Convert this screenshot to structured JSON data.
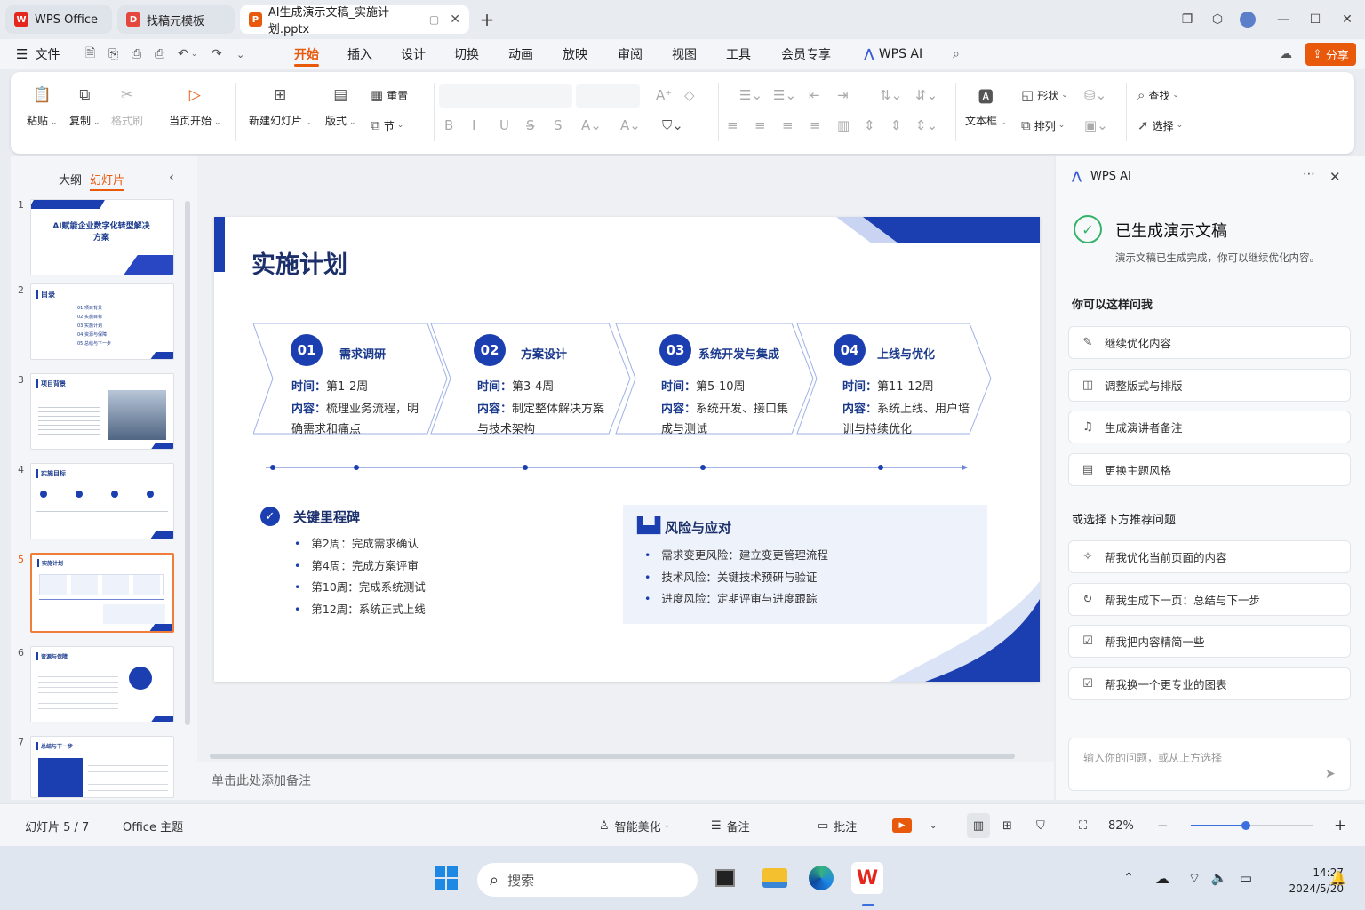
{
  "tabs": [
    {
      "label": "WPS Office"
    },
    {
      "label": "找稿元模板"
    },
    {
      "label": "AI生成演示文稿_实施计划.pptx"
    }
  ],
  "menu": {
    "file": "文件",
    "items": [
      "开始",
      "插入",
      "设计",
      "切换",
      "动画",
      "放映",
      "审阅",
      "视图",
      "工具",
      "会员专享"
    ],
    "wps_ai": "WPS AI",
    "share": "分享"
  },
  "ribbon": {
    "paste": "粘贴",
    "copy": "复制",
    "format_painter": "格式刷",
    "from_current": "当页开始",
    "new_slide": "新建幻灯片",
    "layout": "版式",
    "reset": "重置",
    "section": "节",
    "textbox": "文本框",
    "shape": "形状",
    "arrange": "排列",
    "find": "查找",
    "select": "选择"
  },
  "leftpanel": {
    "outline": "大纲",
    "slides": "幻灯片",
    "thumbs": [
      {
        "num": "1",
        "title": "AI赋能企业数字化转型解决方案"
      },
      {
        "num": "2",
        "title": "目录",
        "items": [
          "01 项目背景",
          "02 实施目标",
          "03 实施计划",
          "04 资源与保障",
          "05 总结与下一步"
        ]
      },
      {
        "num": "3",
        "title": "项目背景"
      },
      {
        "num": "4",
        "title": "实施目标"
      },
      {
        "num": "5",
        "title": "实施计划"
      },
      {
        "num": "6",
        "title": "资源与保障"
      },
      {
        "num": "7",
        "title": "总结与下一步"
      }
    ]
  },
  "slide": {
    "title": "实施计划",
    "steps": [
      {
        "num": "01",
        "title": "需求调研",
        "time_label": "时间",
        "time": "第1-2周",
        "content_label": "内容",
        "content": "梳理业务流程，明确需求和痛点"
      },
      {
        "num": "02",
        "title": "方案设计",
        "time_label": "时间",
        "time": "第3-4周",
        "content_label": "内容",
        "content": "制定整体解决方案与技术架构"
      },
      {
        "num": "03",
        "title": "系统开发与集成",
        "time_label": "时间",
        "time": "第5-10周",
        "content_label": "内容",
        "content": "系统开发、接口集成与测试"
      },
      {
        "num": "04",
        "title": "上线与优化",
        "time_label": "时间",
        "time": "第11-12周",
        "content_label": "内容",
        "content": "系统上线、用户培训与持续优化"
      }
    ],
    "milestones": {
      "title": "关键里程碑",
      "items": [
        "第2周：完成需求确认",
        "第4周：完成方案评审",
        "第10周：完成系统测试",
        "第12周：系统正式上线"
      ]
    },
    "risks": {
      "title": "风险与应对",
      "items": [
        "需求变更风险：建立变更管理流程",
        "技术风险：关键技术预研与验证",
        "进度风险：定期评审与进度跟踪"
      ]
    }
  },
  "notes_placeholder": "单击此处添加备注",
  "ai": {
    "title": "WPS AI",
    "done_title": "已生成演示文稿",
    "done_desc": "演示文稿已生成完成，你可以继续优化内容。",
    "ask_title": "你可以这样问我",
    "ask": [
      "继续优化内容",
      "调整版式与排版",
      "生成演讲者备注",
      "更换主题风格"
    ],
    "rec_title": "或选择下方推荐问题",
    "rec": [
      "帮我优化当前页面的内容",
      "帮我生成下一页：总结与下一步",
      "帮我把内容精简一些",
      "帮我换一个更专业的图表"
    ],
    "input_placeholder": "输入你的问题，或从上方选择"
  },
  "status": {
    "slide_count": "幻灯片 5 / 7",
    "theme": "Office 主题",
    "beautify": "智能美化",
    "notes": "备注",
    "comments": "批注",
    "zoom": "82%",
    "zoom_level": 0.45
  },
  "taskbar": {
    "search": "搜索",
    "time": "14:27",
    "date": "2024/5/20"
  }
}
